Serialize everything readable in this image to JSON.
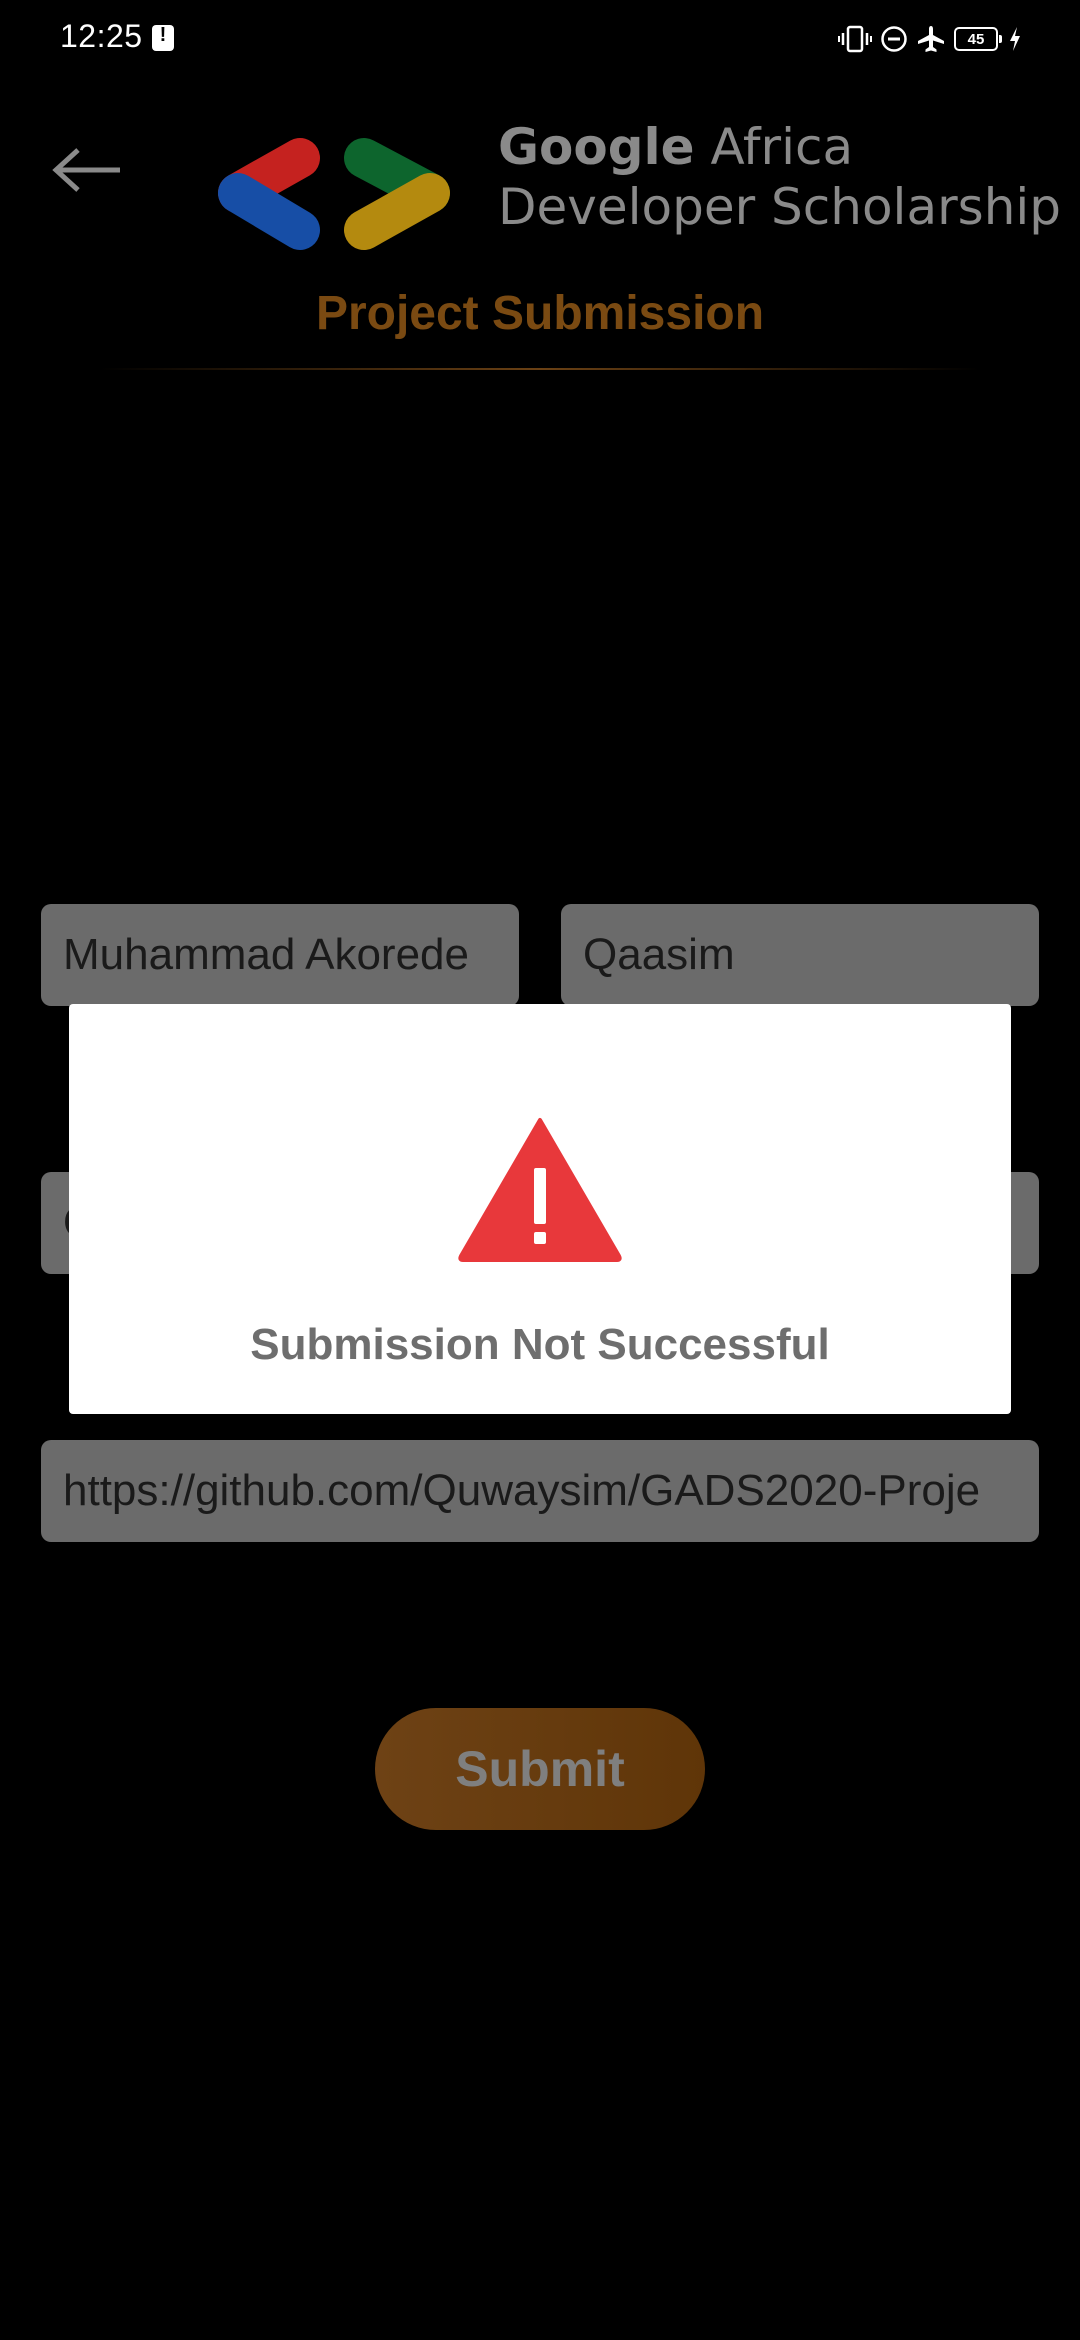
{
  "status_bar": {
    "time": "12:25",
    "battery_level": "45",
    "icons": [
      "alert-icon",
      "vibrate-icon",
      "do-not-disturb-icon",
      "airplane-icon",
      "battery-icon",
      "charging-icon"
    ]
  },
  "header": {
    "back_icon": "arrow-left-icon",
    "brand_google": "Google",
    "brand_africa": "Africa",
    "brand_line2": "Developer Scholarship",
    "title": "Project Submission",
    "title_color": "#7a4a12"
  },
  "form": {
    "first_name": "Muhammad Akorede",
    "last_name": "Qaasim",
    "email": "Q",
    "github_link": "https://github.com/Quwaysim/GADS2020-Proje",
    "field_color": "#6b6b6b"
  },
  "submit": {
    "label": "Submit",
    "color": "#6a3d10"
  },
  "dialog": {
    "icon": "warning-icon",
    "icon_color": "#e8383b",
    "message": "Submission Not Successful"
  },
  "logo_colors": {
    "red": "#c5221f",
    "blue": "#174ea6",
    "green": "#0d652d",
    "yellow": "#b48a0f"
  }
}
